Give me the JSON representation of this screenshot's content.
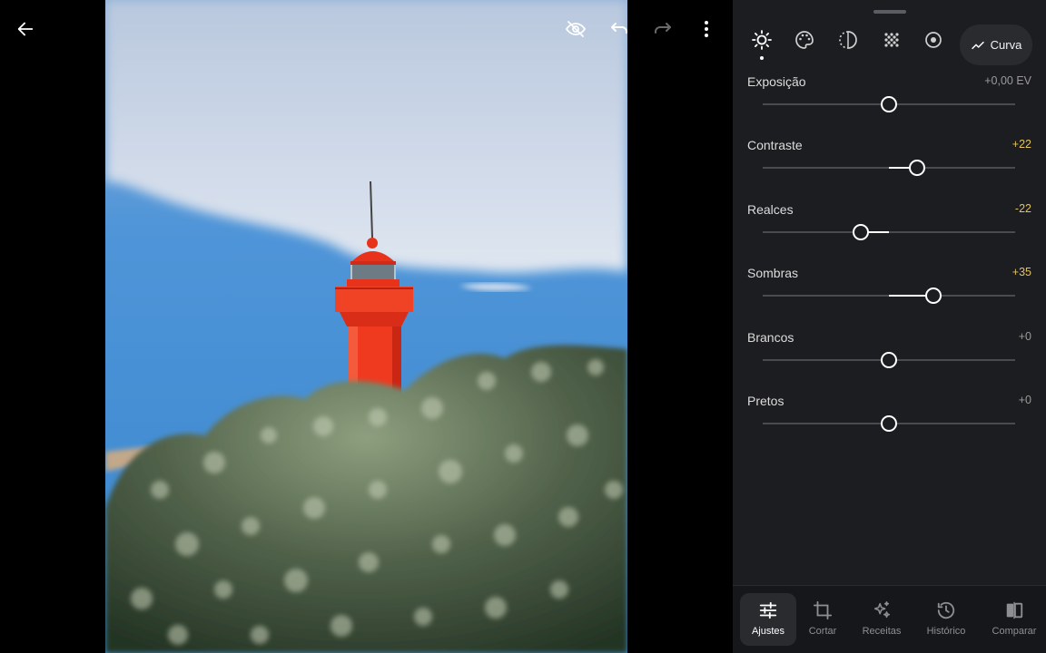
{
  "top_bar": {
    "back_icon": "arrow-left-icon",
    "hide_icon": "eye-off-icon",
    "undo_icon": "undo-icon",
    "redo_icon": "redo-icon",
    "menu_icon": "more-vertical-icon"
  },
  "tool_tabs": [
    {
      "name": "light",
      "icon": "sun-icon",
      "active": true
    },
    {
      "name": "color",
      "icon": "palette-icon",
      "active": false
    },
    {
      "name": "effects",
      "icon": "half-circle-icon",
      "active": false
    },
    {
      "name": "detail",
      "icon": "dots-grid-icon",
      "active": false
    },
    {
      "name": "optics",
      "icon": "lens-icon",
      "active": false
    }
  ],
  "curve_button": {
    "label": "Curva",
    "icon": "curve-icon"
  },
  "adjustments": [
    {
      "label": "Exposição",
      "value": "+0,00 EV",
      "level": 0.0,
      "sign": "zero"
    },
    {
      "label": "Contraste",
      "value": "+22",
      "level": 0.22,
      "sign": "pos"
    },
    {
      "label": "Realces",
      "value": "-22",
      "level": -0.22,
      "sign": "neg"
    },
    {
      "label": "Sombras",
      "value": "+35",
      "level": 0.35,
      "sign": "pos"
    },
    {
      "label": "Brancos",
      "value": "+0",
      "level": 0.0,
      "sign": "zero"
    },
    {
      "label": "Pretos",
      "value": "+0",
      "level": 0.0,
      "sign": "zero"
    }
  ],
  "bottom_nav": [
    {
      "label": "Ajustes",
      "icon": "sliders-icon",
      "active": true
    },
    {
      "label": "Cortar",
      "icon": "crop-icon",
      "active": false
    },
    {
      "label": "Receitas",
      "icon": "sparkles-icon",
      "active": false
    },
    {
      "label": "Histórico",
      "icon": "history-icon",
      "active": false
    },
    {
      "label": "Comparar",
      "icon": "compare-icon",
      "active": false
    }
  ],
  "colors": {
    "panel_bg": "#1c1d20",
    "accent_value": "#e5c35b",
    "lighthouse_red": "#e8331c",
    "sky_blue": "#3f8fd6"
  }
}
